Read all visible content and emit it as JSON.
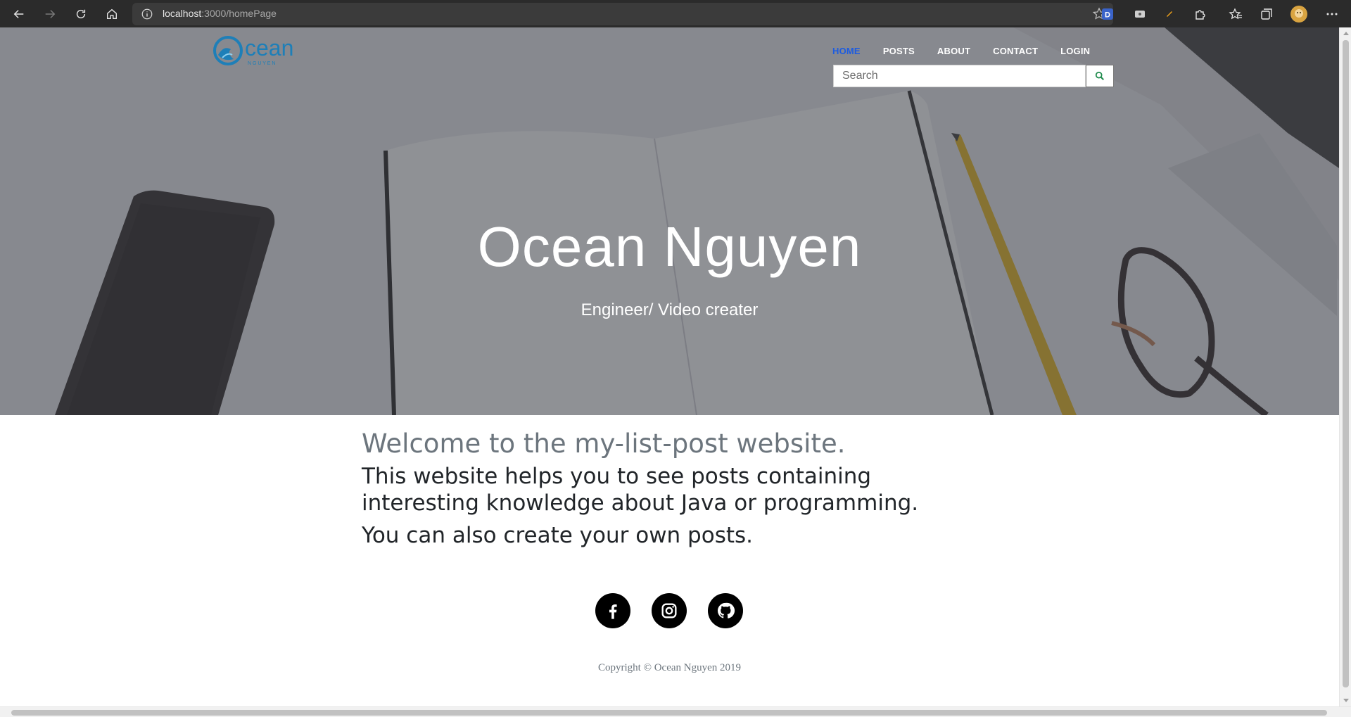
{
  "browser": {
    "url_host": "localhost",
    "url_rest": ":3000/homePage",
    "profile_color": "#d9a441"
  },
  "site": {
    "logo_text": "cean",
    "logo_sub": "N G U Y E N",
    "nav": [
      {
        "label": "HOME",
        "active": true
      },
      {
        "label": "POSTS",
        "active": false
      },
      {
        "label": "ABOUT",
        "active": false
      },
      {
        "label": "CONTACT",
        "active": false
      },
      {
        "label": "LOGIN",
        "active": false
      }
    ],
    "search": {
      "placeholder": "Search",
      "value": ""
    },
    "hero_title": "Ocean Nguyen",
    "hero_subtitle": "Engineer/ Video creater",
    "welcome": "Welcome to the my-list-post website.",
    "description": "This website helps you to see posts containing interesting knowledge about Java or programming.",
    "description2": "You can also create your own posts.",
    "socials": [
      "facebook-icon",
      "instagram-icon",
      "github-icon"
    ],
    "copyright": "Copyright © Ocean Nguyen 2019",
    "colors": {
      "accent": "#1d5ce0",
      "logo": "#1e7fb8",
      "muted": "#6c757d",
      "text": "#212529"
    }
  }
}
